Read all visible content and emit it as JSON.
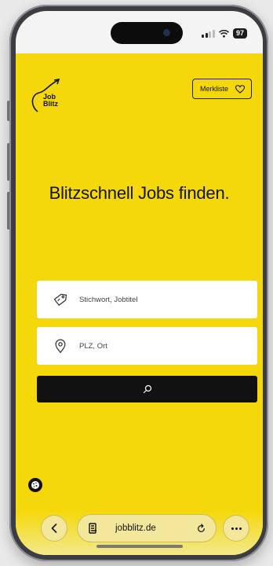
{
  "status_bar": {
    "battery": "97"
  },
  "header": {
    "logo_line1": "Job",
    "logo_line2": "Blitz",
    "wishlist_label": "Merkliste"
  },
  "hero": {
    "title": "Blitzschnell Jobs finden."
  },
  "search": {
    "keyword_placeholder": "Stichwort, Jobtitel",
    "location_placeholder": "PLZ, Ort"
  },
  "browser": {
    "url": "jobblitz.de"
  },
  "colors": {
    "brand_yellow": "#f5d80b",
    "dark": "#111111",
    "white": "#ffffff"
  }
}
